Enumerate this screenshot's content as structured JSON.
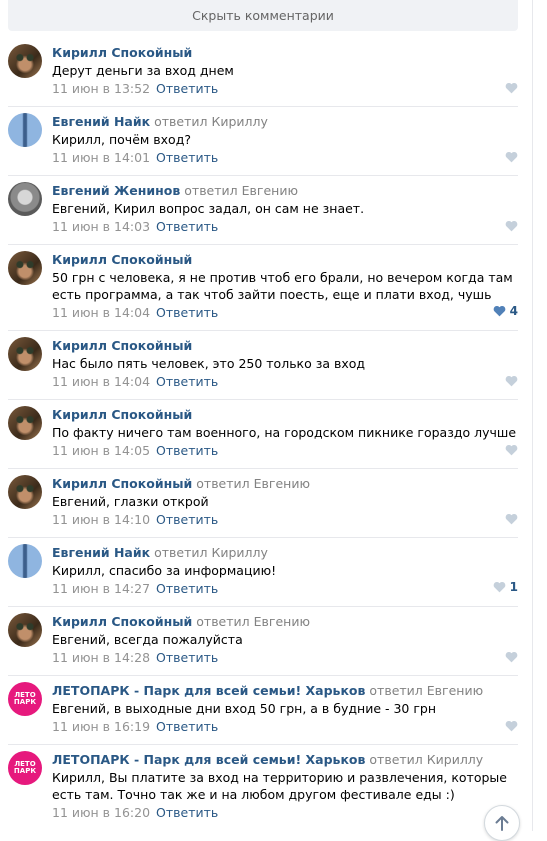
{
  "hide_comments_label": "Скрыть комментарии",
  "reply_label": "Ответить",
  "comments": [
    {
      "author": "Кирилл Спокойный",
      "replied_to": "",
      "text": "Дерут деньги за вход днем",
      "date": "11 июн в 13:52",
      "likes": "",
      "avatar": "cat-avatar"
    },
    {
      "author": "Евгений Найк",
      "replied_to": "ответил Кириллу",
      "text": "Кирилл, почём вход?",
      "date": "11 июн в 14:01",
      "likes": "",
      "avatar": "blue-avatar"
    },
    {
      "author": "Евгений Женинов",
      "replied_to": "ответил Евгению",
      "text": "Евгений, Кирил вопрос задал, он сам не знает.",
      "date": "11 июн в 14:03",
      "likes": "",
      "avatar": "gray-avatar"
    },
    {
      "author": "Кирилл Спокойный",
      "replied_to": "",
      "text": "50 грн с человека, я не против чтоб его брали, но вечером когда там есть программа, а так чтоб зайти поесть, еще и плати вход, чушь",
      "date": "11 июн в 14:04",
      "likes": "4",
      "avatar": "cat-avatar"
    },
    {
      "author": "Кирилл Спокойный",
      "replied_to": "",
      "text": "Нас было пять человек, это 250 только за вход",
      "date": "11 июн в 14:04",
      "likes": "",
      "avatar": "cat-avatar"
    },
    {
      "author": "Кирилл Спокойный",
      "replied_to": "",
      "text": "По факту ничего там военного, на городском пикнике гораздо лучше",
      "date": "11 июн в 14:05",
      "likes": "",
      "avatar": "cat-avatar"
    },
    {
      "author": "Кирилл Спокойный",
      "replied_to": "ответил Евгению",
      "text": "Евгений, глазки открой",
      "date": "11 июн в 14:10",
      "likes": "",
      "avatar": "cat-avatar"
    },
    {
      "author": "Евгений Найк",
      "replied_to": "ответил Кириллу",
      "text": "Кирилл, спасибо за информацию!",
      "date": "11 июн в 14:27",
      "likes": "1",
      "avatar": "blue-avatar"
    },
    {
      "author": "Кирилл Спокойный",
      "replied_to": "ответил Евгению",
      "text": "Евгений, всегда пожалуйста",
      "date": "11 июн в 14:28",
      "likes": "",
      "avatar": "cat-avatar"
    },
    {
      "author": "ЛЕТОПАРК - Парк для всей семьи! Харьков",
      "replied_to": "ответил Евгению",
      "text": "Евгений, в выходные дни вход 50 грн, а в будние - 30 грн",
      "date": "11 июн в 16:19",
      "likes": "",
      "avatar": "letopark-logo"
    },
    {
      "author": "ЛЕТОПАРК - Парк для всей семьи! Харьков",
      "replied_to": "ответил Кириллу",
      "text": "Кирилл, Вы платите за вход на территорию и развлечения, которые есть там. Точно так же и на любом другом фестивале еды :)",
      "date": "11 июн в 16:20",
      "likes": "",
      "avatar": "letopark-logo"
    }
  ],
  "logo_text": "ЛЕТО ПАРК",
  "colors": {
    "link": "#2a5885",
    "meta": "#939393",
    "brand_pink": "#e6197d",
    "liked_heart": "#5181b8",
    "unliked_heart": "#c5d0db"
  }
}
